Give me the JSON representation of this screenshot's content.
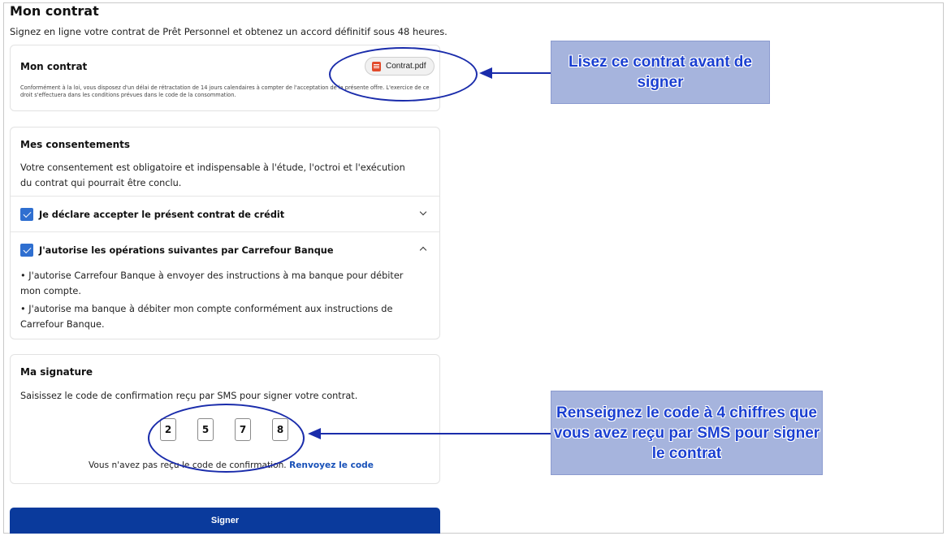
{
  "page": {
    "title": "Mon contrat",
    "subtitle": "Signez en ligne votre contrat de Prêt Personnel et obtenez un accord définitif sous 48 heures."
  },
  "contract_card": {
    "title": "Mon contrat",
    "pdf_label": "Contrat.pdf",
    "pdf_icon": "pdf-file-icon",
    "legal_text": "Conformément à la loi, vous disposez d'un délai de rétractation de 14 jours calendaires à compter de l'acceptation de la présente offre. L'exercice de ce droit s'effectuera dans les conditions prévues dans le code de la consommation."
  },
  "consents_card": {
    "title": "Mes consentements",
    "intro": "Votre consentement est obligatoire et indispensable à l'étude, l'octroi et l'exécution du contrat qui pourrait être conclu.",
    "items": [
      {
        "label": "Je déclare accepter le présent contrat de crédit",
        "checked": true,
        "expanded": false
      },
      {
        "label": "J'autorise les opérations suivantes par Carrefour Banque",
        "checked": true,
        "expanded": true,
        "details": [
          "• J'autorise Carrefour Banque à envoyer des instructions à ma banque pour débiter mon compte.",
          "• J'autorise ma banque à débiter mon compte conformément aux instructions de Carrefour Banque."
        ]
      }
    ]
  },
  "signature_card": {
    "title": "Ma signature",
    "description": "Saisissez le code de confirmation reçu par SMS pour signer votre contrat.",
    "code_digits": [
      "2",
      "5",
      "7",
      "8"
    ],
    "resend_text": "Vous n'avez pas reçu le code de confirmation.",
    "resend_link": "Renvoyez le code"
  },
  "sign_button": {
    "label": "Signer"
  },
  "annotations": {
    "callout_pdf": "Lisez ce contrat avant de signer",
    "callout_code": "Renseignez le code à 4 chiffres que vous avez reçu par SMS pour signer le contrat"
  },
  "colors": {
    "primary_button": "#0a3a9c",
    "checkbox": "#2f6fd0",
    "link": "#1750b8",
    "annotation_stroke": "#1a2cab",
    "callout_fill": "#a6b4dd",
    "callout_text": "#1a3fd1"
  }
}
